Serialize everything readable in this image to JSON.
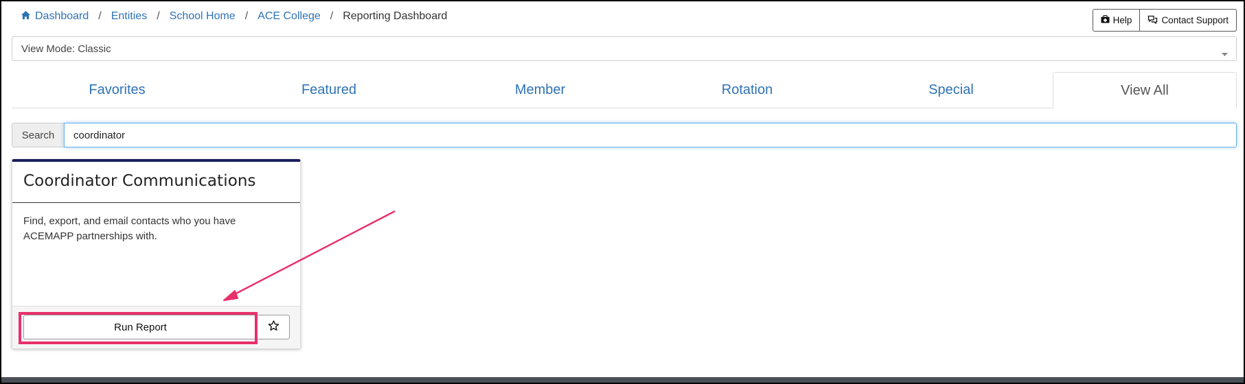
{
  "breadcrumb": {
    "items": [
      "Dashboard",
      "Entities",
      "School Home",
      "ACE College"
    ],
    "current": "Reporting Dashboard",
    "separator": "/"
  },
  "header_buttons": {
    "help_label": "Help",
    "contact_label": "Contact Support"
  },
  "view_mode": {
    "selected": "View Mode: Classic"
  },
  "tabs": [
    {
      "label": "Favorites"
    },
    {
      "label": "Featured"
    },
    {
      "label": "Member"
    },
    {
      "label": "Rotation"
    },
    {
      "label": "Special"
    },
    {
      "label": "View All"
    }
  ],
  "search": {
    "label": "Search",
    "value": "coordinator"
  },
  "card": {
    "title": "Coordinator Communications",
    "description_line1": "Find, export, and email contacts who you have",
    "description_line2": "ACEMAPP partnerships with.",
    "run_label": "Run Report"
  },
  "colors": {
    "link": "#2f72b5",
    "card_accent": "#1b1f5e",
    "annotation": "#e8306b",
    "search_focus": "#66afe9"
  },
  "icons": [
    "home-icon",
    "help-icon",
    "chat-icon",
    "caret-down-icon",
    "star-icon",
    "arrow-annotation"
  ]
}
